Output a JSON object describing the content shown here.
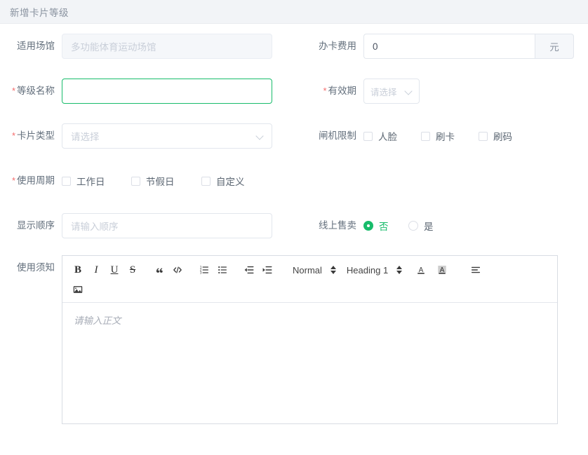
{
  "header": {
    "title": "新增卡片等级"
  },
  "theme": {
    "accent": "#18bc6b",
    "required_star": "#f56c6c",
    "header_bg": "#f2f4f7",
    "border": "#e2e6ed",
    "disabled_bg": "#f5f7fa",
    "placeholder": "#c9cfd9"
  },
  "form": {
    "venue": {
      "label": "适用场馆",
      "value": "多功能体育运动场馆",
      "disabled": true
    },
    "card_fee": {
      "label": "办卡费用",
      "value": "0",
      "unit": "元"
    },
    "level_name": {
      "label": "等级名称",
      "required_mark": "*",
      "value": "",
      "placeholder": "",
      "focused": true
    },
    "validity": {
      "label": "有效期",
      "required_mark": "*",
      "placeholder": "请选择"
    },
    "card_type": {
      "label": "卡片类型",
      "required_mark": "*",
      "placeholder": "请选择"
    },
    "gate_limit": {
      "label": "闸机限制",
      "options": [
        {
          "label": "人脸",
          "checked": false
        },
        {
          "label": "刷卡",
          "checked": false
        },
        {
          "label": "刷码",
          "checked": false
        }
      ]
    },
    "use_cycle": {
      "label": "使用周期",
      "required_mark": "*",
      "options": [
        {
          "label": "工作日",
          "checked": false
        },
        {
          "label": "节假日",
          "checked": false
        },
        {
          "label": "自定义",
          "checked": false
        }
      ]
    },
    "display_order": {
      "label": "显示顺序",
      "value": "",
      "placeholder": "请输入顺序"
    },
    "online_sale": {
      "label": "线上售卖",
      "options": [
        {
          "label": "否",
          "checked": true
        },
        {
          "label": "是",
          "checked": false
        }
      ]
    },
    "notice": {
      "label": "使用须知",
      "placeholder": "请输入正文",
      "value": "",
      "toolbar": {
        "bold": "B",
        "italic": "I",
        "underline": "U",
        "strike": "S",
        "blockquote_icon": "blockquote-icon",
        "code_icon": "code-icon",
        "ordered_list_icon": "ordered-list-icon",
        "bullet_list_icon": "bullet-list-icon",
        "outdent_icon": "outdent-icon",
        "indent_icon": "indent-icon",
        "size_picker": "Normal",
        "header_picker": "Heading 1",
        "font_color_icon": "font-color-icon",
        "background_color_icon": "background-color-icon",
        "align_icon": "align-icon",
        "image_icon": "image-icon"
      }
    }
  }
}
